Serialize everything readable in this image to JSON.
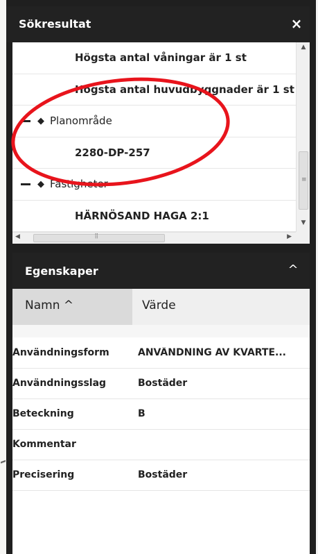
{
  "search_results": {
    "title": "Sökresultat",
    "close_icon": "×",
    "rows": [
      {
        "type": "child",
        "label": "Högsta antal våningar är 1 st"
      },
      {
        "type": "child",
        "label": "Högsta antal huvudbyggnader är 1 st"
      },
      {
        "type": "group",
        "label": "Planområde"
      },
      {
        "type": "child",
        "label": "2280-DP-257"
      },
      {
        "type": "group",
        "label": "Fastigheter"
      },
      {
        "type": "child",
        "label": "HÄRNÖSAND HAGA 2:1"
      }
    ]
  },
  "properties": {
    "title": "Egenskaper",
    "collapse_icon": "^",
    "columns": {
      "name": "Namn ^",
      "value": "Värde"
    },
    "rows": [
      {
        "key": "Användningsform",
        "value": "ANVÄNDNING AV KVARTE..."
      },
      {
        "key": "Användningsslag",
        "value": "Bostäder"
      },
      {
        "key": "Beteckning",
        "value": "B"
      },
      {
        "key": "Kommentar",
        "value": ""
      },
      {
        "key": "Precisering",
        "value": "Bostäder"
      }
    ]
  },
  "colors": {
    "panel_bg": "#222222",
    "annotation": "#e8141c"
  }
}
